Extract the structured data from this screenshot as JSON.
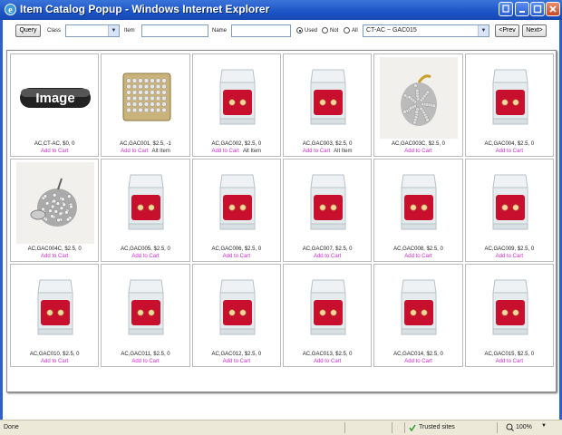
{
  "window": {
    "title": "Item Catalog Popup - Windows Internet Explorer",
    "icon": "ie-icon",
    "buttons": [
      "restore-icon",
      "minimize-icon",
      "maximize-icon",
      "close-icon"
    ]
  },
  "toolbar": {
    "query_label": "Query",
    "class_label": "Class",
    "class_value": "",
    "item_label": "Item",
    "item_value": "",
    "name_label": "Name",
    "name_value": "",
    "radio_used": "Used",
    "radio_not": "Not",
    "radio_all": "All",
    "selected_radio": "Used",
    "range_value": "CT-AC ~ GAC015",
    "prev_label": "<Prev",
    "next_label": "Next>"
  },
  "items": [
    {
      "caption": "AC,CT-AC, $0, 0",
      "add": "Add to Cart",
      "alt": "",
      "img": "placeholder"
    },
    {
      "caption": "AC,GAC001, $2.5, -1",
      "add": "Add to Cart",
      "alt": "Alt Item",
      "img": "square"
    },
    {
      "caption": "AC,GAC002, $2.5, 0",
      "add": "Add to Cart",
      "alt": "Alt Item",
      "img": "box"
    },
    {
      "caption": "AC,GAC003, $2.5, 0",
      "add": "Add to Cart",
      "alt": "Alt Item",
      "img": "box"
    },
    {
      "caption": "AC,GAC003C, $2.5, 0",
      "add": "Add to Cart",
      "alt": "",
      "img": "pendant"
    },
    {
      "caption": "AC,GAC004, $2.5, 0",
      "add": "Add to Cart",
      "alt": "",
      "img": "box"
    },
    {
      "caption": "AC,GAC004C, $2.5, 0",
      "add": "Add to Cart",
      "alt": "",
      "img": "apple"
    },
    {
      "caption": "AC,GAC005, $2.5, 0",
      "add": "Add to Cart",
      "alt": "",
      "img": "box"
    },
    {
      "caption": "AC,GAC006, $2.5, 0",
      "add": "Add to Cart",
      "alt": "",
      "img": "box"
    },
    {
      "caption": "AC,GAC007, $2.5, 0",
      "add": "Add to Cart",
      "alt": "",
      "img": "box"
    },
    {
      "caption": "AC,GAC008, $2.5, 0",
      "add": "Add to Cart",
      "alt": "",
      "img": "box"
    },
    {
      "caption": "AC,GAC009, $2.5, 0",
      "add": "Add to Cart",
      "alt": "",
      "img": "box"
    },
    {
      "caption": "AC,GAC010, $2.5, 0",
      "add": "Add to Cart",
      "alt": "",
      "img": "box"
    },
    {
      "caption": "AC,GAC011, $2.5, 0",
      "add": "Add to Cart",
      "alt": "",
      "img": "box"
    },
    {
      "caption": "AC,GAC012, $2.5, 0",
      "add": "Add to Cart",
      "alt": "",
      "img": "box"
    },
    {
      "caption": "AC,GAC013, $2.5, 0",
      "add": "Add to Cart",
      "alt": "",
      "img": "box"
    },
    {
      "caption": "AC,GAC014, $2.5, 0",
      "add": "Add to Cart",
      "alt": "",
      "img": "box"
    },
    {
      "caption": "AC,GAC015, $2.5, 0",
      "add": "Add to Cart",
      "alt": "",
      "img": "box"
    }
  ],
  "placeholder_text": "Image",
  "status": {
    "left": "Done",
    "zone": "Trusted sites",
    "zoom": "100%"
  },
  "colors": {
    "titlebar": "#1d55c6",
    "add_link": "#d02ad0",
    "velvet": "#c8102e"
  }
}
